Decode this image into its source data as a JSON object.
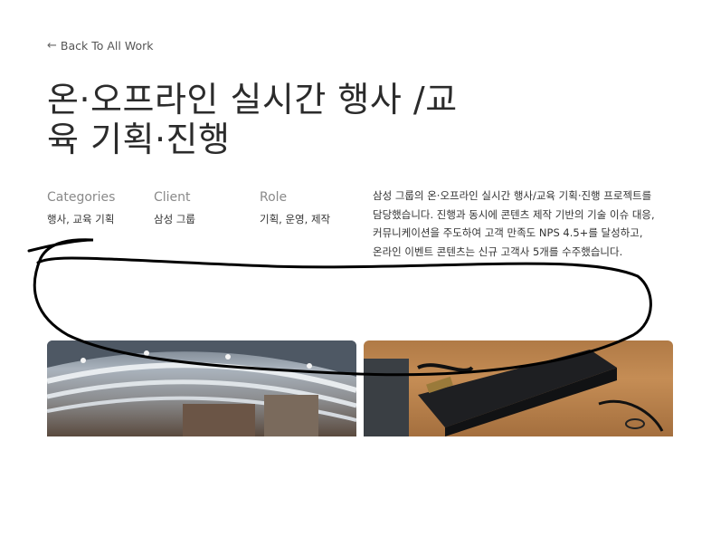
{
  "nav": {
    "back_label": "Back To All Work",
    "back_icon": "arrow-left-icon"
  },
  "project": {
    "title_line1": "온·오프라인 실시간 행사 /교",
    "title_line2": "육 기획·진행"
  },
  "meta": {
    "categories_label": "Categories",
    "categories_value": "행사, 교육 기획",
    "client_label": "Client",
    "client_value": "삼성 그룹",
    "role_label": "Role",
    "role_value": "기획, 운영, 제작"
  },
  "description": {
    "line1": "삼성 그룹의 온·오프라인 실시간 행사/교육 기획·진행 프로젝트를",
    "line2": "담당했습니다. 진행과 동시에 콘텐츠 제작 기반의 기술 이슈 대응,",
    "line3": "커뮤니케이션을 주도하여 고객 만족도 NPS 4.5+를 달성하고,",
    "line4": "온라인 이벤트 콘텐츠는 신규 고객사 5개를 수주했습니다."
  },
  "colors": {
    "text": "#2b2b2b",
    "muted": "#8a8a8a",
    "scribble": "#000000"
  }
}
